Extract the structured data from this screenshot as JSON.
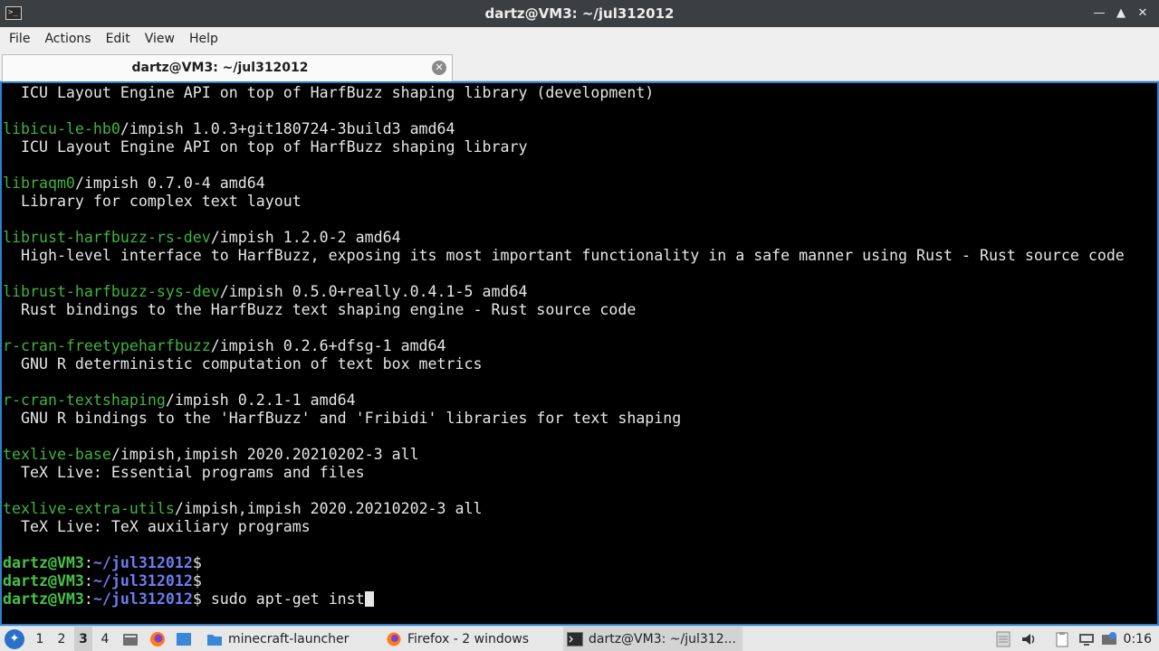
{
  "window": {
    "title": "dartz@VM3: ~/jul312012",
    "app_icon": "terminal-icon",
    "controls": [
      "minimize-icon",
      "maximize-icon",
      "close-icon"
    ]
  },
  "menubar": {
    "items": [
      "File",
      "Actions",
      "Edit",
      "View",
      "Help"
    ]
  },
  "tab": {
    "label": "dartz@VM3: ~/jul312012",
    "close_icon": "close-tab-icon"
  },
  "terminal": {
    "lines": [
      {
        "pkg": "",
        "rest": "  ICU Layout Engine API on top of HarfBuzz shaping library (development)"
      },
      {
        "pkg": "",
        "rest": ""
      },
      {
        "pkg": "libicu-le-hb0",
        "rest": "/impish 1.0.3+git180724-3build3 amd64"
      },
      {
        "pkg": "",
        "rest": "  ICU Layout Engine API on top of HarfBuzz shaping library"
      },
      {
        "pkg": "",
        "rest": ""
      },
      {
        "pkg": "libraqm0",
        "rest": "/impish 0.7.0-4 amd64"
      },
      {
        "pkg": "",
        "rest": "  Library for complex text layout"
      },
      {
        "pkg": "",
        "rest": ""
      },
      {
        "pkg": "librust-harfbuzz-rs-dev",
        "rest": "/impish 1.2.0-2 amd64"
      },
      {
        "pkg": "",
        "rest": "  High-level interface to HarfBuzz, exposing its most important functionality in a safe manner using Rust - Rust source code"
      },
      {
        "pkg": "",
        "rest": ""
      },
      {
        "pkg": "librust-harfbuzz-sys-dev",
        "rest": "/impish 0.5.0+really.0.4.1-5 amd64"
      },
      {
        "pkg": "",
        "rest": "  Rust bindings to the HarfBuzz text shaping engine - Rust source code"
      },
      {
        "pkg": "",
        "rest": ""
      },
      {
        "pkg": "r-cran-freetypeharfbuzz",
        "rest": "/impish 0.2.6+dfsg-1 amd64"
      },
      {
        "pkg": "",
        "rest": "  GNU R deterministic computation of text box metrics"
      },
      {
        "pkg": "",
        "rest": ""
      },
      {
        "pkg": "r-cran-textshaping",
        "rest": "/impish 0.2.1-1 amd64"
      },
      {
        "pkg": "",
        "rest": "  GNU R bindings to the 'HarfBuzz' and 'Fribidi' libraries for text shaping"
      },
      {
        "pkg": "",
        "rest": ""
      },
      {
        "pkg": "texlive-base",
        "rest": "/impish,impish 2020.20210202-3 all"
      },
      {
        "pkg": "",
        "rest": "  TeX Live: Essential programs and files"
      },
      {
        "pkg": "",
        "rest": ""
      },
      {
        "pkg": "texlive-extra-utils",
        "rest": "/impish,impish 2020.20210202-3 all"
      },
      {
        "pkg": "",
        "rest": "  TeX Live: TeX auxiliary programs"
      },
      {
        "pkg": "",
        "rest": ""
      }
    ],
    "prompts": [
      {
        "user": "dartz@VM3",
        "path": "~/jul312012",
        "command": ""
      },
      {
        "user": "dartz@VM3",
        "path": "~/jul312012",
        "command": ""
      },
      {
        "user": "dartz@VM3",
        "path": "~/jul312012",
        "command": " sudo apt-get inst"
      }
    ],
    "prompt_symbol": "$",
    "colors": {
      "package": "#3fb33f",
      "user": "#46c346",
      "path": "#6e7cf0",
      "text": "#e6e6e6",
      "border": "#2f7fd0"
    }
  },
  "taskbar": {
    "start_icon": "start-menu-icon",
    "workspaces": [
      "1",
      "2",
      "3",
      "4"
    ],
    "active_workspace": "3",
    "quick_launch": [
      "file-manager-icon",
      "firefox-icon",
      "show-desktop-icon"
    ],
    "tasks": [
      {
        "label": "minecraft-launcher",
        "icon": "folder-icon",
        "active": false
      },
      {
        "label": "Firefox - 2 windows",
        "icon": "firefox-icon",
        "active": false
      },
      {
        "label": "dartz@VM3: ~/jul312...",
        "icon": "terminal-icon",
        "active": true
      }
    ],
    "tray": [
      "notes-icon",
      "volume-icon",
      "clipboard-icon",
      "display-icon",
      "network-icon"
    ],
    "clock": "0:16"
  }
}
